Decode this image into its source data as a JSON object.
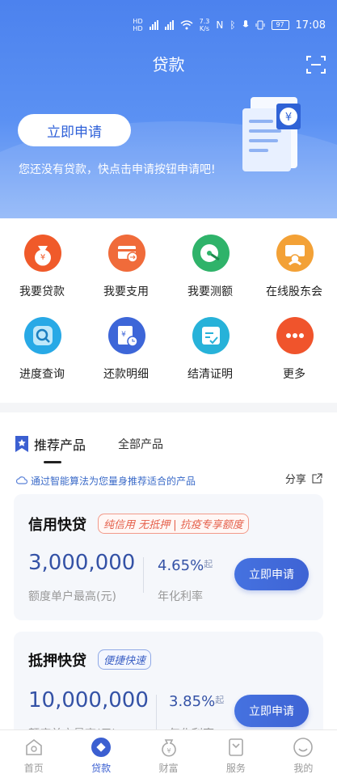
{
  "status_bar": {
    "net": "7.3\nK/s",
    "net_top": "7.3",
    "net_bottom": "K/s",
    "battery": "97",
    "time": "17:08"
  },
  "header": {
    "title": "贷款"
  },
  "hero": {
    "apply_label": "立即申请",
    "hint": "您还没有贷款，快点击申请按钮申请吧!"
  },
  "grid": {
    "items": [
      {
        "label": "我要贷款",
        "color": "#f05a2a"
      },
      {
        "label": "我要支用",
        "color": "#f06b3a"
      },
      {
        "label": "我要测额",
        "color": "#2fb36a"
      },
      {
        "label": "在线股东会",
        "color": "#f3a136"
      },
      {
        "label": "进度查询",
        "color": "#28a9e6"
      },
      {
        "label": "还款明细",
        "color": "#3d66d8"
      },
      {
        "label": "结清证明",
        "color": "#27b2d9"
      },
      {
        "label": "更多",
        "color": "#f0542c"
      }
    ]
  },
  "products": {
    "tab_active": "推荐产品",
    "tab_other": "全部产品",
    "recommend_text": "通过智能算法为您量身推荐适合的产品",
    "share_label": "分享",
    "cards": [
      {
        "title": "信用快贷",
        "tag": "纯信用 无抵押 | 抗疫专享额度",
        "amount": "3,000,000",
        "amount_sub": "额度单户最高(元)",
        "rate": "4.65%",
        "rate_suffix": "起",
        "rate_sub": "年化利率",
        "button": "立即申请"
      },
      {
        "title": "抵押快贷",
        "tag": "便捷快速",
        "amount": "10,000,000",
        "amount_sub": "额度单户最高(元)",
        "rate": "3.85%",
        "rate_suffix": "起",
        "rate_sub": "年化利率",
        "button": "立即申请"
      }
    ]
  },
  "nav": {
    "items": [
      {
        "label": "首页"
      },
      {
        "label": "贷款"
      },
      {
        "label": "财富"
      },
      {
        "label": "服务"
      },
      {
        "label": "我的"
      }
    ]
  },
  "colors": {
    "brand": "#4c82ee",
    "accent": "#3b5fd1"
  }
}
